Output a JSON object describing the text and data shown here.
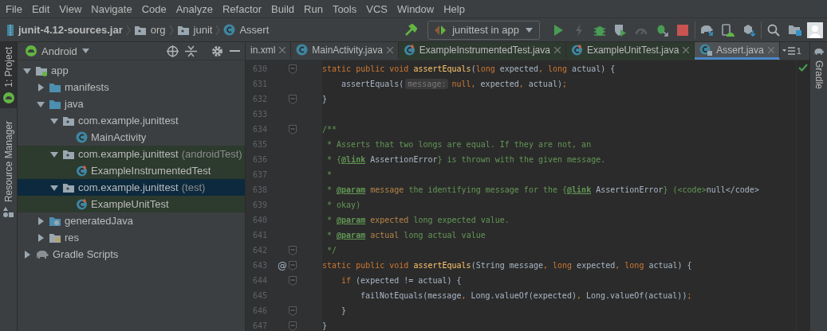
{
  "menu": [
    "File",
    "Edit",
    "View",
    "Navigate",
    "Code",
    "Analyze",
    "Refactor",
    "Build",
    "Run",
    "Tools",
    "VCS",
    "Window",
    "Help"
  ],
  "breadcrumb": [
    {
      "label": "junit-4.12-sources.jar",
      "kind": "jar"
    },
    {
      "label": "org",
      "kind": "package"
    },
    {
      "label": "junit",
      "kind": "package"
    },
    {
      "label": "Assert",
      "kind": "class"
    }
  ],
  "run_config": "junittest in app",
  "toolbar_groups": [
    [
      {
        "kind": "build",
        "disabled": false
      }
    ],
    [
      {
        "kind": "run",
        "disabled": false
      },
      {
        "kind": "apply_changes",
        "disabled": true
      },
      {
        "kind": "debug",
        "disabled": false
      },
      {
        "kind": "coverage",
        "disabled": false
      },
      {
        "kind": "profile",
        "disabled": true
      },
      {
        "kind": "attach_debugger",
        "disabled": false
      },
      {
        "kind": "stop",
        "disabled": false
      }
    ],
    [
      {
        "kind": "sync",
        "disabled": false
      },
      {
        "kind": "avd",
        "disabled": false
      },
      {
        "kind": "sdk",
        "disabled": false
      }
    ],
    [
      {
        "kind": "search",
        "disabled": false
      },
      {
        "kind": "project_structure",
        "disabled": false
      },
      {
        "kind": "avatar",
        "disabled": false
      }
    ]
  ],
  "left_tool_tabs": [
    {
      "label": "1: Project",
      "kind": "android",
      "selected": true
    },
    {
      "label": "Resource Manager",
      "kind": "resources",
      "selected": false
    }
  ],
  "right_tool_tabs": [
    {
      "label": "Gradle",
      "kind": "gradle",
      "selected": false
    }
  ],
  "project_panel": {
    "view": "Android",
    "tree": [
      {
        "label": "app",
        "kind": "module",
        "expanded": true,
        "selected": false,
        "test_scope": false,
        "children": [
          {
            "label": "manifests",
            "kind": "folder",
            "expanded": false,
            "selected": false,
            "test_scope": false
          },
          {
            "label": "java",
            "kind": "folder",
            "expanded": true,
            "selected": false,
            "test_scope": false,
            "children": [
              {
                "label": "com.example.junittest",
                "kind": "package",
                "expanded": true,
                "selected": false,
                "test_scope": false,
                "children": [
                  {
                    "label": "MainActivity",
                    "kind": "class",
                    "selected": false,
                    "test_scope": false
                  }
                ]
              },
              {
                "label": "com.example.junittest",
                "suffix": "(androidTest)",
                "kind": "package",
                "expanded": true,
                "selected": false,
                "test_scope": true,
                "children": [
                  {
                    "label": "ExampleInstrumentedTest",
                    "kind": "test_class",
                    "selected": false,
                    "test_scope": true
                  }
                ]
              },
              {
                "label": "com.example.junittest",
                "suffix": "(test)",
                "kind": "package",
                "expanded": true,
                "selected": true,
                "test_scope": false,
                "children": [
                  {
                    "label": "ExampleUnitTest",
                    "kind": "test_class",
                    "selected": false,
                    "test_scope": true
                  }
                ]
              }
            ]
          },
          {
            "label": "generatedJava",
            "kind": "generated_folder",
            "expanded": false,
            "selected": false,
            "test_scope": false
          },
          {
            "label": "res",
            "kind": "res_folder",
            "expanded": false,
            "selected": false,
            "test_scope": false
          }
        ]
      },
      {
        "label": "Gradle Scripts",
        "kind": "gradle",
        "expanded": false,
        "selected": false,
        "test_scope": false
      }
    ]
  },
  "editor_tabs": [
    {
      "label": "in.xml",
      "kind": "none",
      "selected": false,
      "test_scope": false
    },
    {
      "label": "MainActivity.java",
      "kind": "class",
      "selected": false,
      "test_scope": false
    },
    {
      "label": "ExampleInstrumentedTest.java",
      "kind": "test_class",
      "selected": false,
      "test_scope": true
    },
    {
      "label": "ExampleUnitTest.java",
      "kind": "test_class",
      "selected": false,
      "test_scope": true
    },
    {
      "label": "Assert.java",
      "kind": "locked_class",
      "selected": true,
      "test_scope": false
    }
  ],
  "tab_overflow": "1",
  "code_lines": [
    {
      "number": "630",
      "fold": true,
      "tokens": [
        {
          "kind": "kw",
          "text": "static public void "
        },
        {
          "kind": "fn",
          "text": "assertEquals"
        },
        {
          "kind": "plain",
          "text": "("
        },
        {
          "kind": "kw",
          "text": "long"
        },
        {
          "kind": "plain",
          "text": " expected"
        },
        {
          "kind": "punct",
          "text": ", "
        },
        {
          "kind": "kw",
          "text": "long"
        },
        {
          "kind": "plain",
          "text": " actual) {"
        }
      ],
      "children": [
        {
          "number": "631",
          "fold": false,
          "tokens": [
            {
              "kind": "plain",
              "text": "assertEquals("
            },
            {
              "kind": "hint",
              "text": "message:"
            },
            {
              "kind": "kw",
              "text": "null"
            },
            {
              "kind": "punct",
              "text": ", "
            },
            {
              "kind": "plain",
              "text": "expected"
            },
            {
              "kind": "punct",
              "text": ", "
            },
            {
              "kind": "plain",
              "text": "actual)"
            },
            {
              "kind": "punct",
              "text": ";"
            }
          ]
        }
      ]
    },
    {
      "number": "632",
      "fold": true,
      "tokens": [
        {
          "kind": "plain",
          "text": "}"
        }
      ]
    },
    {
      "number": "633",
      "fold": false
    },
    {
      "number": "634",
      "fold": true,
      "tokens": [
        {
          "kind": "comment",
          "text": "/**"
        }
      ]
    },
    {
      "number": "635",
      "fold": false,
      "tokens": [
        {
          "kind": "comment",
          "text": " * Asserts that two longs are equal. If they are not, an"
        }
      ]
    },
    {
      "number": "636",
      "fold": false,
      "tokens": [
        {
          "kind": "comment",
          "text": " * {"
        },
        {
          "kind": "tag",
          "text": "@link"
        },
        {
          "kind": "ref",
          "text": " AssertionError"
        },
        {
          "kind": "comment",
          "text": "} is thrown with the given message."
        }
      ]
    },
    {
      "number": "637",
      "fold": false,
      "tokens": [
        {
          "kind": "comment",
          "text": " *"
        }
      ]
    },
    {
      "number": "638",
      "fold": false,
      "tokens": [
        {
          "kind": "comment",
          "text": " * "
        },
        {
          "kind": "tag",
          "text": "@param"
        },
        {
          "kind": "pname",
          "text": " message"
        },
        {
          "kind": "comment",
          "text": " the identifying message for the {"
        },
        {
          "kind": "tag",
          "text": "@link"
        },
        {
          "kind": "ref",
          "text": " AssertionError"
        },
        {
          "kind": "comment",
          "text": "} (<code>"
        },
        {
          "kind": "ref",
          "text": "null</code>"
        }
      ]
    },
    {
      "number": "639",
      "fold": false,
      "tokens": [
        {
          "kind": "comment",
          "text": " * okay)"
        }
      ]
    },
    {
      "number": "640",
      "fold": false,
      "tokens": [
        {
          "kind": "comment",
          "text": " * "
        },
        {
          "kind": "tag",
          "text": "@param"
        },
        {
          "kind": "pname",
          "text": " expected"
        },
        {
          "kind": "comment",
          "text": " long expected value."
        }
      ]
    },
    {
      "number": "641",
      "fold": false,
      "tokens": [
        {
          "kind": "comment",
          "text": " * "
        },
        {
          "kind": "tag",
          "text": "@param"
        },
        {
          "kind": "pname",
          "text": " actual"
        },
        {
          "kind": "comment",
          "text": " long actual value"
        }
      ]
    },
    {
      "number": "642",
      "fold": true,
      "tokens": [
        {
          "kind": "comment",
          "text": " */"
        }
      ]
    },
    {
      "number": "643",
      "fold": true,
      "annotation": "@",
      "tokens": [
        {
          "kind": "kw",
          "text": "static public void "
        },
        {
          "kind": "fn",
          "text": "assertEquals"
        },
        {
          "kind": "plain",
          "text": "(String message"
        },
        {
          "kind": "punct",
          "text": ", "
        },
        {
          "kind": "kw",
          "text": "long"
        },
        {
          "kind": "plain",
          "text": " expected"
        },
        {
          "kind": "punct",
          "text": ", "
        },
        {
          "kind": "kw",
          "text": "long"
        },
        {
          "kind": "plain",
          "text": " actual) {"
        }
      ],
      "children": [
        {
          "number": "644",
          "fold": true,
          "tokens": [
            {
              "kind": "kw",
              "text": "if"
            },
            {
              "kind": "plain",
              "text": " (expected != actual) {"
            }
          ],
          "children": [
            {
              "number": "645",
              "fold": false,
              "tokens": [
                {
                  "kind": "plain",
                  "text": "failNotEquals(message"
                },
                {
                  "kind": "punct",
                  "text": ", "
                },
                {
                  "kind": "plain",
                  "text": "Long.valueOf(expected)"
                },
                {
                  "kind": "punct",
                  "text": ", "
                },
                {
                  "kind": "plain",
                  "text": "Long.valueOf(actual))"
                },
                {
                  "kind": "punct",
                  "text": ";"
                }
              ]
            }
          ]
        },
        {
          "number": "646",
          "fold": true,
          "tokens": [
            {
              "kind": "plain",
              "text": "}"
            }
          ]
        }
      ]
    },
    {
      "number": "647",
      "fold": true,
      "tokens": [
        {
          "kind": "plain",
          "text": "}"
        }
      ]
    }
  ]
}
